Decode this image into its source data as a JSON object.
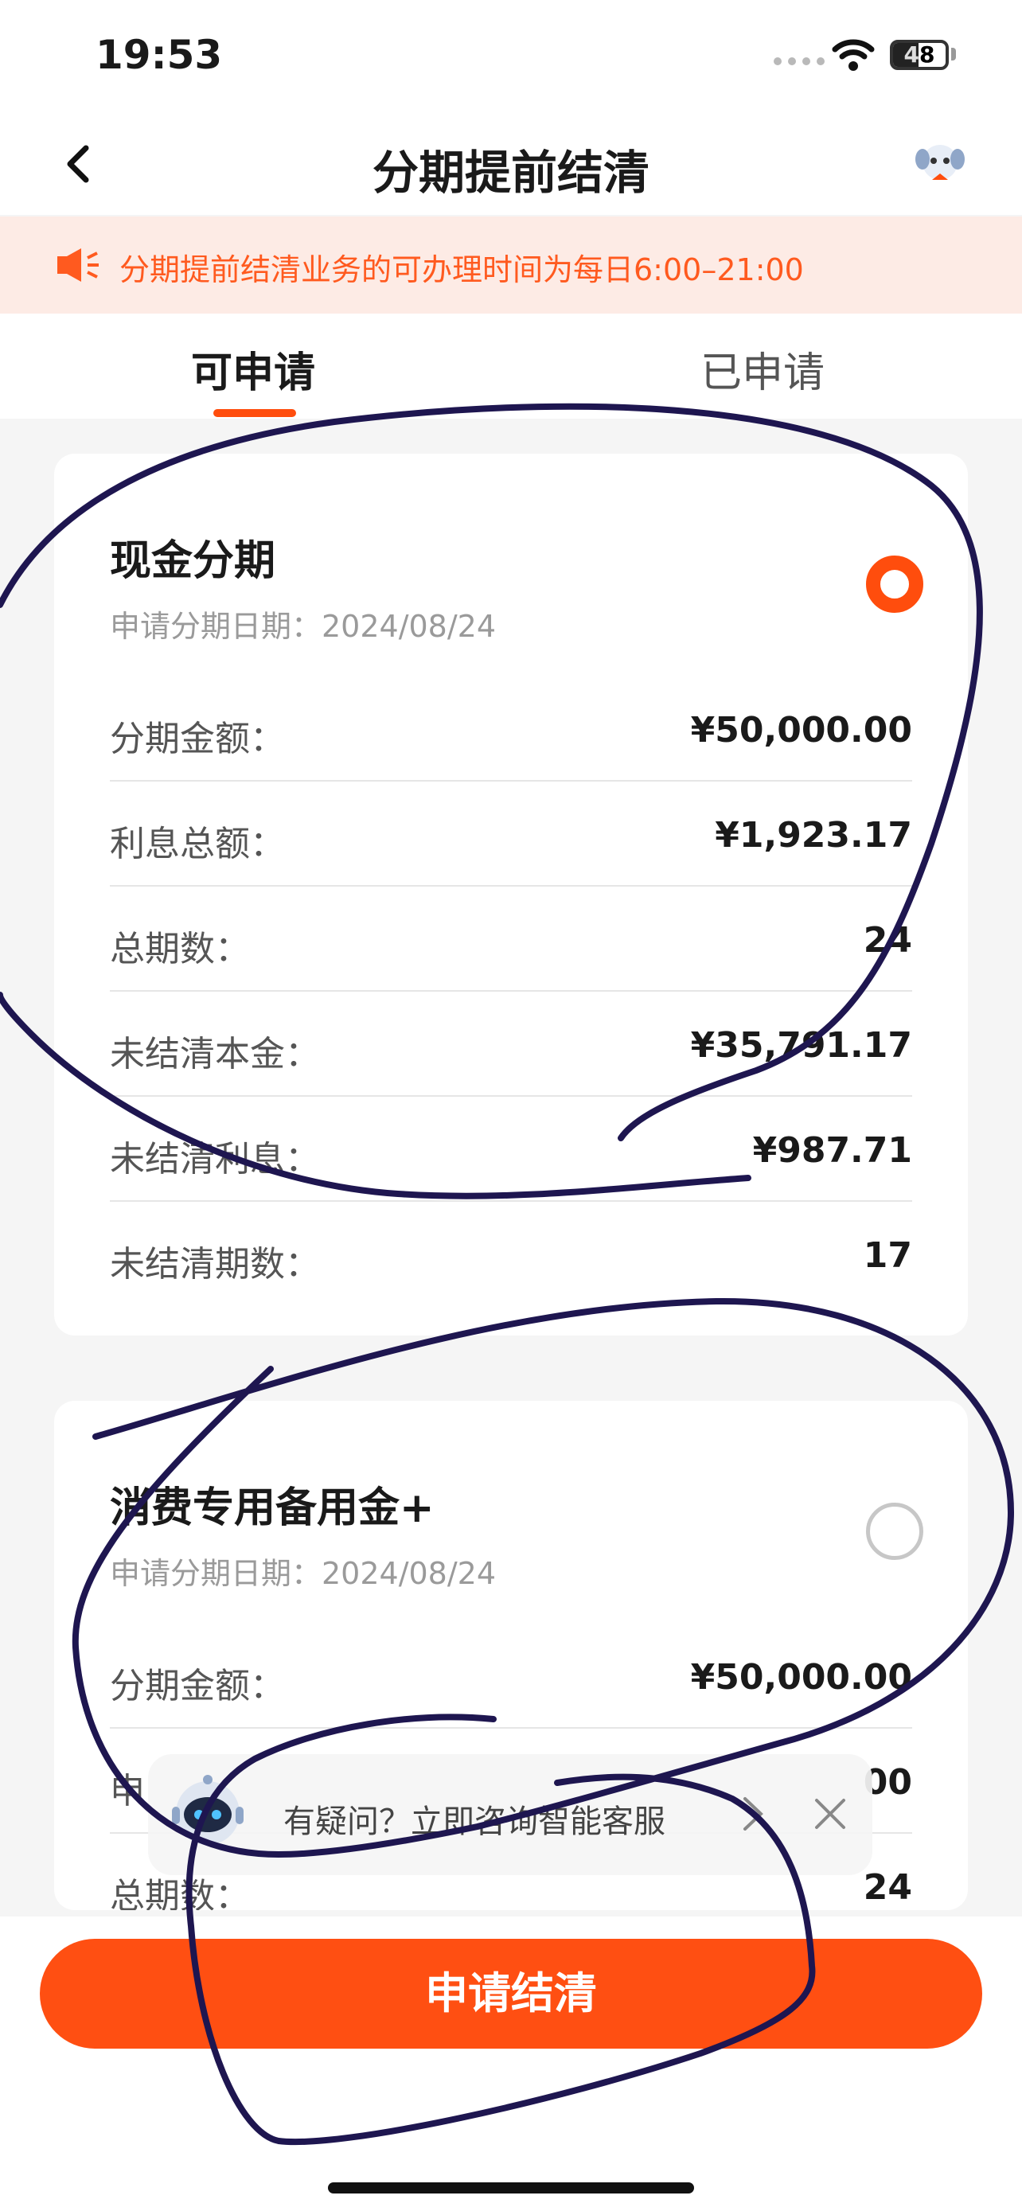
{
  "status_bar": {
    "time": "19:53",
    "battery": "48",
    "battery_level": 0.48
  },
  "nav": {
    "title": "分期提前结清"
  },
  "notice": {
    "text": "分期提前结清业务的可办理时间为每日6:00–21:00"
  },
  "tabs": [
    {
      "label": "可申请",
      "active": true
    },
    {
      "label": "已申请",
      "active": false
    }
  ],
  "cards": [
    {
      "title": "现金分期",
      "date": "申请分期日期：2024/08/24",
      "selected": true,
      "rows": [
        {
          "label": "分期金额：",
          "value": "¥50,000.00"
        },
        {
          "label": "利息总额：",
          "value": "¥1,923.17"
        },
        {
          "label": "总期数：",
          "value": "24"
        },
        {
          "label": "未结清本金：",
          "value": "¥35,791.17"
        },
        {
          "label": "未结清利息：",
          "value": "¥987.71"
        },
        {
          "label": "未结清期数：",
          "value": "17"
        }
      ]
    },
    {
      "title": "消费专用备用金+",
      "date": "申请分期日期：2024/08/24",
      "selected": false,
      "rows": [
        {
          "label": "分期金额：",
          "value": "¥50,000.00"
        },
        {
          "label": "申",
          "value": "00"
        },
        {
          "label": "总期数：",
          "value": "24"
        }
      ]
    }
  ],
  "assistant": {
    "text": "有疑问？立即咨询智能客服"
  },
  "apply_button": {
    "label": "申请结清"
  },
  "colors": {
    "accent": "#ff4d0d",
    "notice_bg": "#fdebe5",
    "ink": "#1e1650"
  }
}
